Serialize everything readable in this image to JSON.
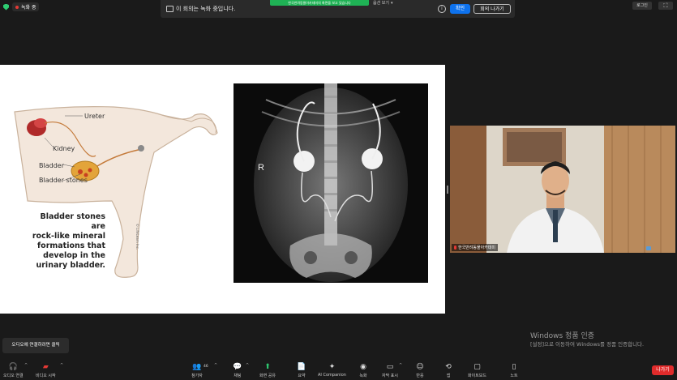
{
  "status": {
    "recording_label": "녹화 중"
  },
  "banner": {
    "text": "이 회의는 녹화 중입니다.",
    "confirm_label": "확인",
    "leave_label": "회의 나가기"
  },
  "share_notice": "한국반려동물아카데미의 화면을 보고 있습니다",
  "view_option": "옵션 보기",
  "login_label": "로그인",
  "slide": {
    "illustration_labels": [
      "Ureter",
      "Kidney",
      "Bladder",
      "Bladder stones"
    ],
    "caption_lines": [
      "Bladder stones are",
      "rock-like mineral",
      "formations that",
      "develop in the",
      "urinary bladder."
    ],
    "copyright": "© LifeLearn Inc.",
    "xray_marker": "R"
  },
  "video": {
    "participant_name": "한국반려동물아카데미"
  },
  "windows": {
    "title": "Windows 정품 인증",
    "subtitle": "[설정]으로 이동하여 Windows를 정품 인증합니다."
  },
  "tooltip": "오디오에 연결하려면 클릭",
  "toolbar": {
    "audio": "오디오 연결",
    "video": "비디오 시작",
    "participants": "참가자",
    "participants_count": "46",
    "chat": "채팅",
    "share": "화면 공유",
    "summary": "요약",
    "ai": "AI Companion",
    "record": "녹화",
    "captions": "자막 표시",
    "reactions": "반응",
    "apps": "앱",
    "whiteboard": "화이트보드",
    "notes": "노트",
    "leave": "나가기"
  },
  "colors": {
    "accent": "#0e72ed",
    "share_green": "#1fb255",
    "leave_red": "#e02b2b"
  }
}
